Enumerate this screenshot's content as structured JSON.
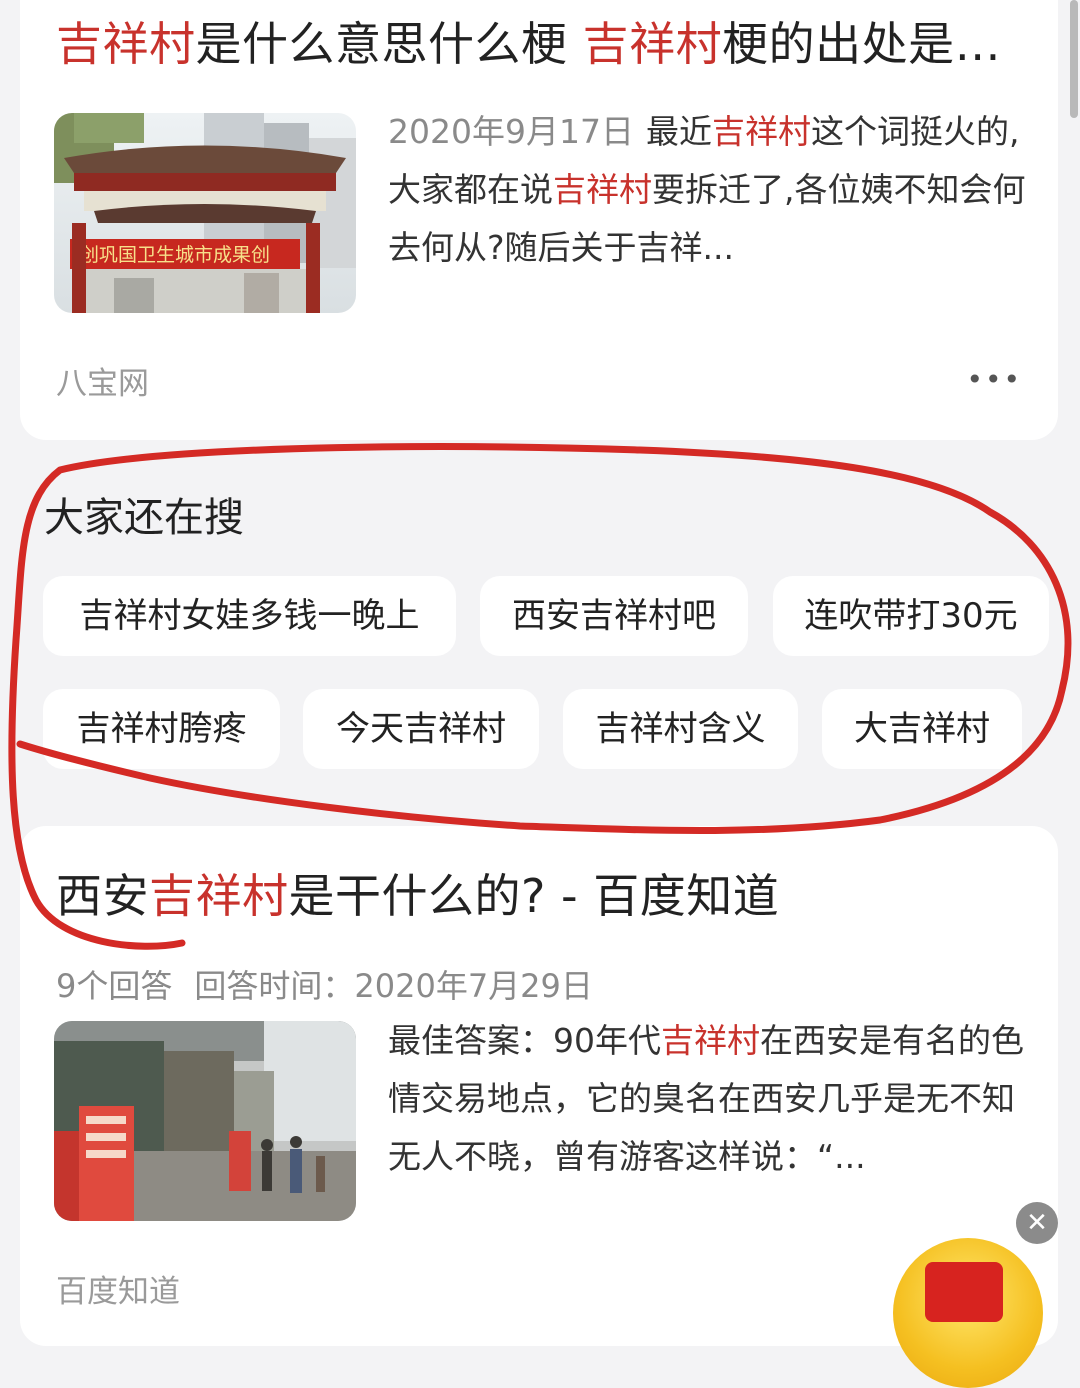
{
  "results": [
    {
      "title_parts": [
        {
          "text": "吉祥村",
          "hl": true
        },
        {
          "text": "是什么意思什么梗 ",
          "hl": false
        },
        {
          "text": "吉祥村",
          "hl": true
        },
        {
          "text": "梗的出处是…",
          "hl": false
        }
      ],
      "date": "2020年9月17日",
      "snippet_parts": [
        {
          "text": "最近",
          "hl": false
        },
        {
          "text": "吉祥村",
          "hl": true
        },
        {
          "text": "这个词挺火的,大家都在说",
          "hl": false
        },
        {
          "text": "吉祥村",
          "hl": true
        },
        {
          "text": "要拆迁了,各位姨不知会何去何从?随后关于吉祥...",
          "hl": false
        }
      ],
      "source": "八宝网",
      "more_label": "•••",
      "image_icon": "archway-gate-photo",
      "image_banner_text": "创巩国卫生城市成果创"
    },
    {
      "title_parts": [
        {
          "text": "西安",
          "hl": false
        },
        {
          "text": "吉祥村",
          "hl": true
        },
        {
          "text": "是干什么的? - 百度知道",
          "hl": false
        }
      ],
      "answer_count": "9个回答",
      "answer_time": "回答时间：2020年7月29日",
      "snippet_parts": [
        {
          "text": "最佳答案：90年代",
          "hl": false
        },
        {
          "text": "吉祥村",
          "hl": true
        },
        {
          "text": "在西安是有名的色情交易地点，它的臭名在西安几乎是无不知无人不晓，曾有游客这样说：“...",
          "hl": false
        }
      ],
      "source": "百度知道",
      "image_icon": "street-storefront-photo"
    }
  ],
  "related": {
    "title": "大家还在搜",
    "chips": [
      "吉祥村女娃多钱一晚上",
      "西安吉祥村吧",
      "连吹带打30元",
      "吉祥村胯疼",
      "今天吉祥村",
      "吉祥村含义",
      "大吉祥村"
    ]
  },
  "close_label": "✕",
  "colors": {
    "highlight": "#c8322c",
    "annotation": "#d42a25",
    "background": "#f3f3f5"
  }
}
